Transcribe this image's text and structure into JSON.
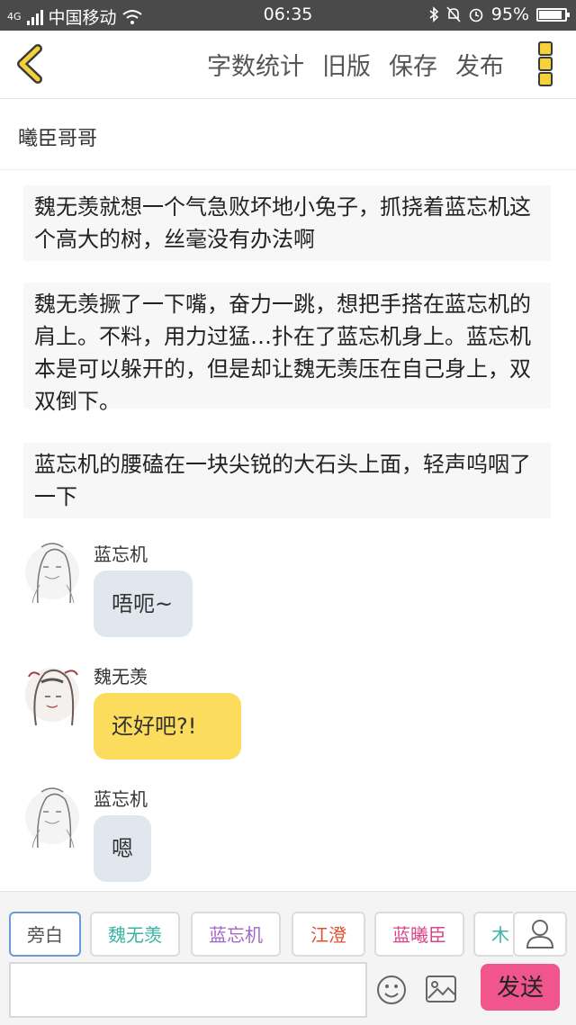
{
  "status_bar": {
    "network": "4G",
    "carrier": "中国移动",
    "time": "06:35",
    "battery_percent": "95%",
    "battery_level": 0.95
  },
  "toolbar": {
    "back_icon": "chevron-left-icon",
    "word_count_label": "字数统计",
    "old_version_label": "旧版",
    "save_label": "保存",
    "publish_label": "发布",
    "menu_icon": "more-vertical-icon",
    "accent_color": "#f5d23c"
  },
  "story": {
    "title": "曦臣哥哥"
  },
  "narrations": [
    "魏无羡就想一个气急败坏地小兔子，抓挠着蓝忘机这个高大的树，丝毫没有办法啊",
    "魏无羡撅了一下嘴，奋力一跳，想把手搭在蓝忘机的肩上。不料，用力过猛…扑在了蓝忘机身上。蓝忘机本是可以躲开的，但是却让魏无羡压在自己身上，双双倒下。",
    "蓝忘机的腰磕在一块尖锐的大石头上面，轻声呜咽了一下"
  ],
  "messages": [
    {
      "name": "蓝忘机",
      "text": "唔呃~",
      "bubble": "grey"
    },
    {
      "name": "魏无羡",
      "text": "还好吧?!",
      "bubble": "yellow"
    },
    {
      "name": "蓝忘机",
      "text": "嗯",
      "bubble": "grey"
    }
  ],
  "characters": [
    {
      "label": "旁白",
      "color": "#555555",
      "selected": true
    },
    {
      "label": "魏无羡",
      "color": "#3bb3a6"
    },
    {
      "label": "蓝忘机",
      "color": "#a466c6"
    },
    {
      "label": "江澄",
      "color": "#e0522e"
    },
    {
      "label": "蓝曦臣",
      "color": "#d6458a"
    },
    {
      "label": "木",
      "color": "#3bb3a6"
    }
  ],
  "composer": {
    "input_value": "",
    "emoji_icon": "smiley-icon",
    "image_icon": "image-icon",
    "user_icon": "user-icon",
    "send_label": "发送",
    "send_color": "#f0558c"
  }
}
